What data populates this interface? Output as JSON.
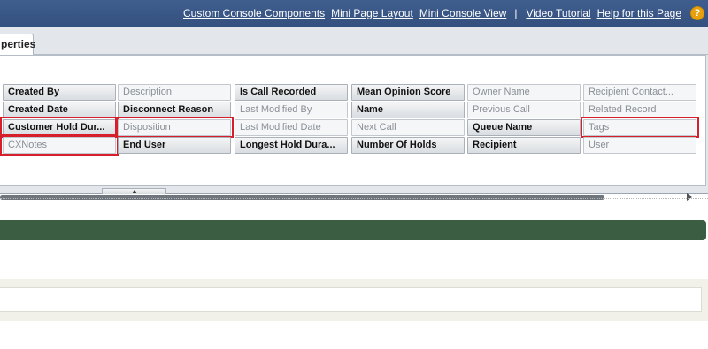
{
  "header": {
    "links": [
      "Custom Console Components",
      "Mini Page Layout",
      "Mini Console View",
      "Video Tutorial",
      "Help for this Page"
    ],
    "separator": "|",
    "help_glyph": "?"
  },
  "palette": {
    "tab_label": "perties",
    "columns": [
      [
        {
          "label": "Created By",
          "state": "on"
        },
        {
          "label": "Created Date",
          "state": "on"
        },
        {
          "label": "Customer Hold Dur...",
          "state": "on"
        },
        {
          "label": "CXNotes",
          "state": "off"
        }
      ],
      [
        {
          "label": "Description",
          "state": "off"
        },
        {
          "label": "Disconnect Reason",
          "state": "on"
        },
        {
          "label": "Disposition",
          "state": "off"
        },
        {
          "label": "End User",
          "state": "on"
        }
      ],
      [
        {
          "label": "Is Call Recorded",
          "state": "on"
        },
        {
          "label": "Last Modified By",
          "state": "off"
        },
        {
          "label": "Last Modified Date",
          "state": "off"
        },
        {
          "label": "Longest Hold Dura...",
          "state": "on"
        }
      ],
      [
        {
          "label": "Mean Opinion Score",
          "state": "on"
        },
        {
          "label": "Name",
          "state": "on"
        },
        {
          "label": "Next Call",
          "state": "off"
        },
        {
          "label": "Number Of Holds",
          "state": "on"
        }
      ],
      [
        {
          "label": "Owner Name",
          "state": "off"
        },
        {
          "label": "Previous Call",
          "state": "off"
        },
        {
          "label": "Queue Name",
          "state": "on"
        },
        {
          "label": "Recipient",
          "state": "on"
        }
      ],
      [
        {
          "label": "Recipient Contact...",
          "state": "off"
        },
        {
          "label": "Related Record",
          "state": "off"
        },
        {
          "label": "Tags",
          "state": "off"
        },
        {
          "label": "User",
          "state": "off"
        }
      ]
    ],
    "highlighted": [
      "Customer Hold Dur...",
      "CXNotes",
      "Disposition",
      "Tags"
    ]
  },
  "colors": {
    "header_bg": "#3f5e8f",
    "highlight": "#d61f2b",
    "section_bar": "#3b5e43",
    "help_icon": "#e8a10c"
  }
}
